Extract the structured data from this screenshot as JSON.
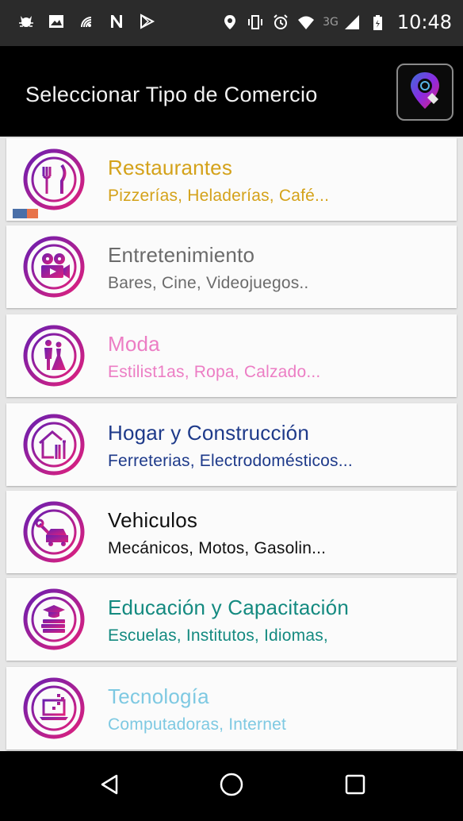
{
  "status_bar": {
    "time": "10:48",
    "network": "3G",
    "left_icons": [
      "cat-icon",
      "image-icon",
      "nfc-icon",
      "n-icon",
      "play-store-icon"
    ],
    "right_icons": [
      "location-icon",
      "vibrate-icon",
      "alarm-icon",
      "wifi-icon",
      "signal-icon",
      "battery-icon"
    ]
  },
  "app_bar": {
    "title": "Seleccionar Tipo de Comercio",
    "logo_icon": "location-pin-logo-icon"
  },
  "categories": [
    {
      "name": "Restaurantes",
      "desc": "Pizzerías, Heladerías, Café...",
      "color": "#d4a21a",
      "icon": "cutlery-icon"
    },
    {
      "name": "Entretenimiento",
      "desc": "Bares, Cine, Videojuegos..",
      "color": "#6b6b6b",
      "icon": "film-camera-icon"
    },
    {
      "name": "Moda",
      "desc": "Estilist1as, Ropa, Calzado...",
      "color": "#ec7dc4",
      "icon": "couple-icon"
    },
    {
      "name": "Hogar y Construcción",
      "desc": "Ferreterias, Electrodomésticos...",
      "color": "#1e3a8a",
      "icon": "house-tools-icon"
    },
    {
      "name": "Vehiculos",
      "desc": "Mecánicos, Motos, Gasolin...",
      "color": "#111111",
      "icon": "car-wrench-icon"
    },
    {
      "name": "Educación y Capacitación",
      "desc": "Escuelas, Institutos, Idiomas,",
      "color": "#148a80",
      "icon": "graduation-books-icon"
    },
    {
      "name": "Tecnología",
      "desc": "Computadoras, Internet",
      "color": "#7ec9e2",
      "icon": "laptop-icon"
    }
  ],
  "accent_colors": {
    "gradient_start": "#6a1fb0",
    "gradient_end": "#e0207c"
  },
  "nav_bar": {
    "back_icon": "back-triangle-icon",
    "home_icon": "home-circle-icon",
    "recents_icon": "recents-square-icon"
  }
}
